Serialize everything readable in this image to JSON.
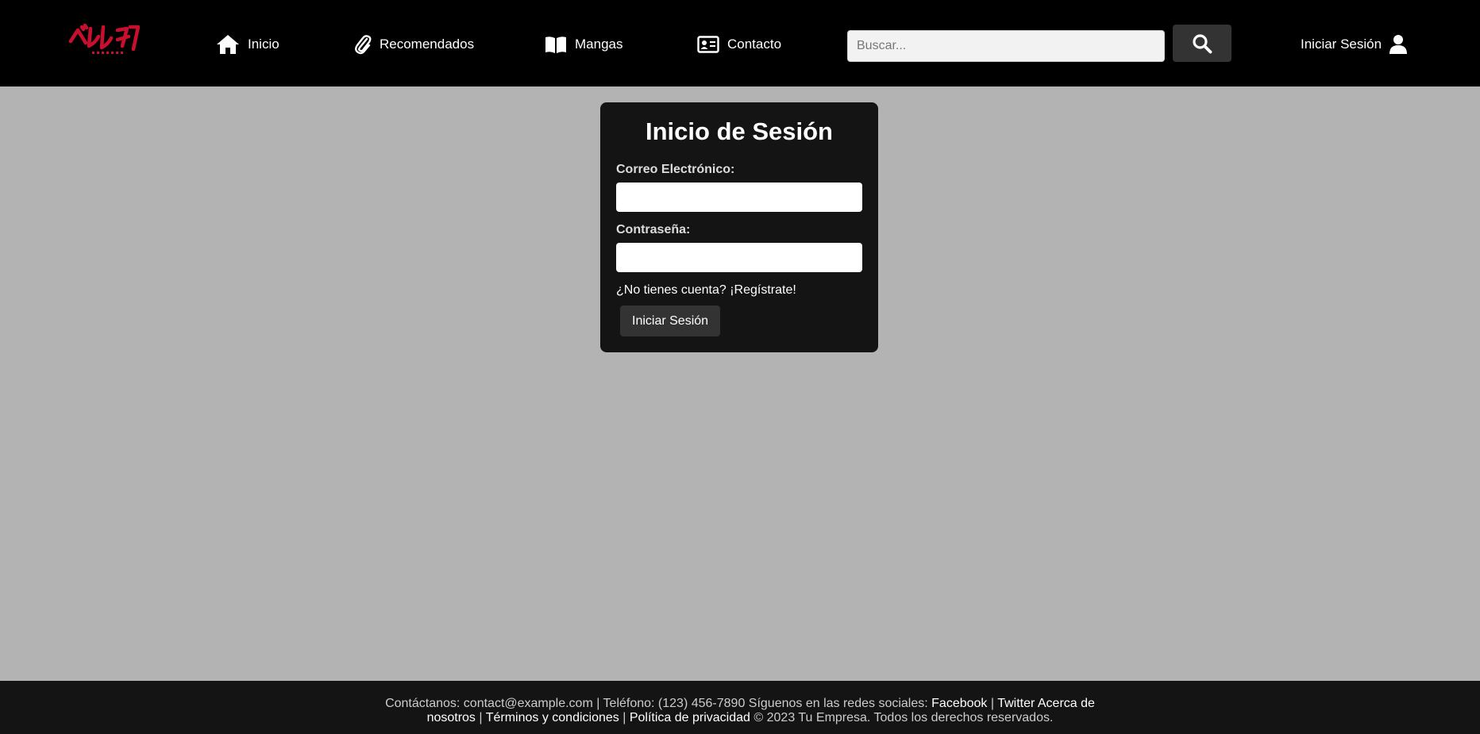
{
  "header": {
    "logo_alt": "ベルセルク",
    "nav": [
      {
        "label": "Inicio",
        "icon": "home-icon"
      },
      {
        "label": "Recomendados",
        "icon": "paperclip-icon"
      },
      {
        "label": "Mangas",
        "icon": "book-open-icon"
      },
      {
        "label": "Contacto",
        "icon": "id-card-icon"
      }
    ],
    "search": {
      "placeholder": "Buscar...",
      "value": "",
      "icon": "search-icon"
    },
    "login_label": "Iniciar Sesión",
    "login_icon": "user-icon"
  },
  "login_form": {
    "title": "Inicio de Sesión",
    "email_label": "Correo Electrónico:",
    "email_value": "",
    "password_label": "Contraseña:",
    "password_value": "",
    "register_prompt": "¿No tienes cuenta?",
    "register_link": "¡Regístrate!",
    "submit_label": "Iniciar Sesión"
  },
  "footer": {
    "contact_prefix": "Contáctanos: contact@example.com | Teléfono: (123) 456-7890 Síguenos en las redes sociales:",
    "facebook": "Facebook",
    "separator": "|",
    "twitter": "Twitter",
    "about": "Acerca de nosotros",
    "terms": "Términos y condiciones",
    "privacy": "Política de privacidad",
    "copyright": "© 2023 Tu Empresa. Todos los derechos reservados."
  },
  "colors": {
    "header_bg": "#000000",
    "page_bg": "#b3b3b3",
    "card_bg": "#141414",
    "footer_bg": "#141414",
    "button_bg": "#333333",
    "logo_red": "#c8102e"
  }
}
